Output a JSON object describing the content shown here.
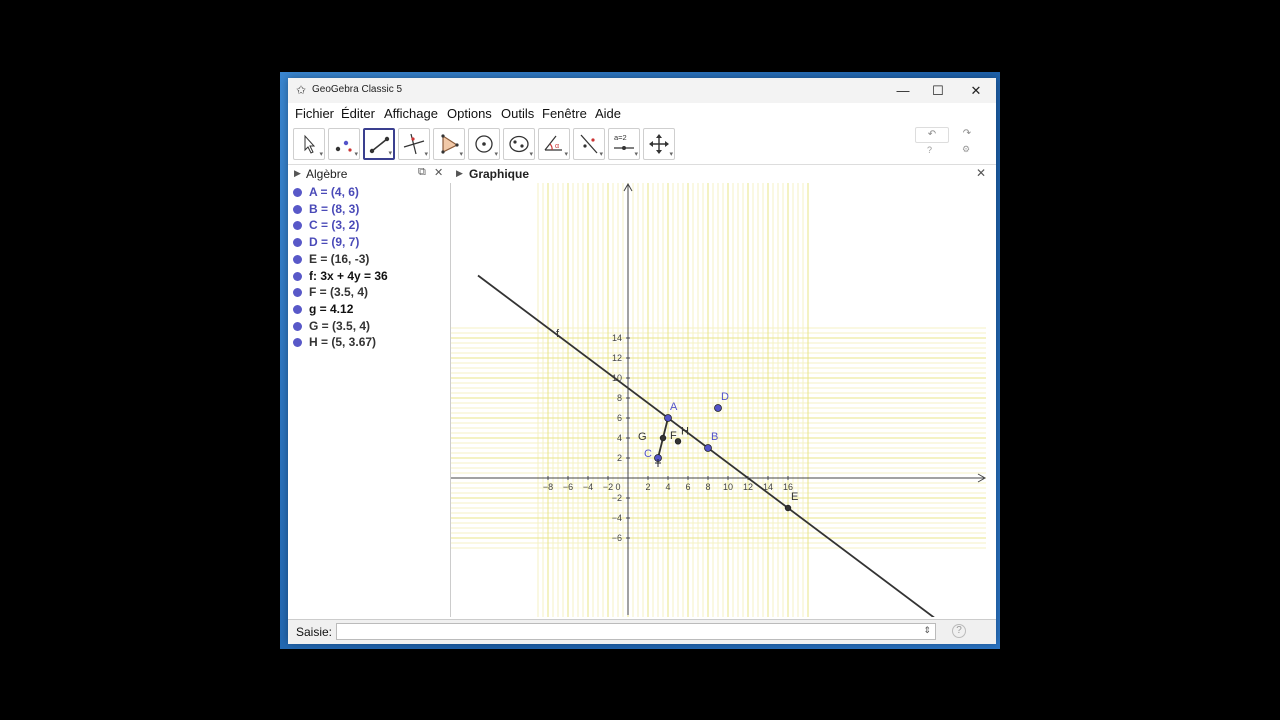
{
  "window": {
    "title": "GeoGebra Classic 5",
    "minimize": "—",
    "maximize": "☐",
    "close": "✕"
  },
  "menu": [
    "Fichier",
    "Éditer",
    "Affichage",
    "Options",
    "Outils",
    "Fenêtre",
    "Aide"
  ],
  "toolbar": {
    "tools": [
      "move-tool",
      "point-tool",
      "segment-tool",
      "perpendicular-tool",
      "polygon-tool",
      "circle-center-tool",
      "ellipse-tool",
      "angle-tool",
      "reflect-tool",
      "slider-tool",
      "move-graphics-tool"
    ],
    "selected": "segment-tool",
    "slider_label": "a=2",
    "undo": "↶",
    "redo": "↷"
  },
  "algebra": {
    "title": "Algèbre",
    "items": [
      {
        "text": "A = (4, 6)",
        "color": "#4a4ab8"
      },
      {
        "text": "B = (8, 3)",
        "color": "#4a4ab8"
      },
      {
        "text": "C = (3, 2)",
        "color": "#4a4ab8"
      },
      {
        "text": "D = (9, 7)",
        "color": "#4a4ab8"
      },
      {
        "text": "E = (16, -3)",
        "color": "#333333"
      },
      {
        "text": "f: 3x + 4y = 36",
        "color": "#111111"
      },
      {
        "text": "F = (3.5, 4)",
        "color": "#333333"
      },
      {
        "text": "g = 4.12",
        "color": "#111111"
      },
      {
        "text": "G = (3.5, 4)",
        "color": "#333333"
      },
      {
        "text": "H = (5, 3.67)",
        "color": "#333333"
      }
    ]
  },
  "graphics": {
    "title": "Graphique",
    "x_ticks": [
      "−8",
      "−6",
      "−4",
      "−2",
      "0",
      "2",
      "4",
      "6",
      "8",
      "10",
      "12",
      "14",
      "16"
    ],
    "y_ticks": [
      "14",
      "12",
      "10",
      "8",
      "6",
      "4",
      "2",
      "−2",
      "−4",
      "−6"
    ],
    "labels": {
      "A": "A",
      "B": "B",
      "C": "C",
      "D": "D",
      "E": "E",
      "F": "F",
      "G": "G",
      "H": "H",
      "f": "f"
    },
    "points": {
      "A": [
        4,
        6
      ],
      "B": [
        8,
        3
      ],
      "C": [
        3,
        2
      ],
      "D": [
        9,
        7
      ],
      "E": [
        16,
        -3
      ],
      "G": [
        3.5,
        4
      ],
      "H": [
        5,
        3.67
      ]
    },
    "colors": {
      "free_point": "#5353c9",
      "dep_point": "#333333",
      "line": "#333333",
      "grid_major": "#e8e48a",
      "grid_minor": "#f4f2c4"
    }
  },
  "input": {
    "label": "Saisie:",
    "value": ""
  }
}
